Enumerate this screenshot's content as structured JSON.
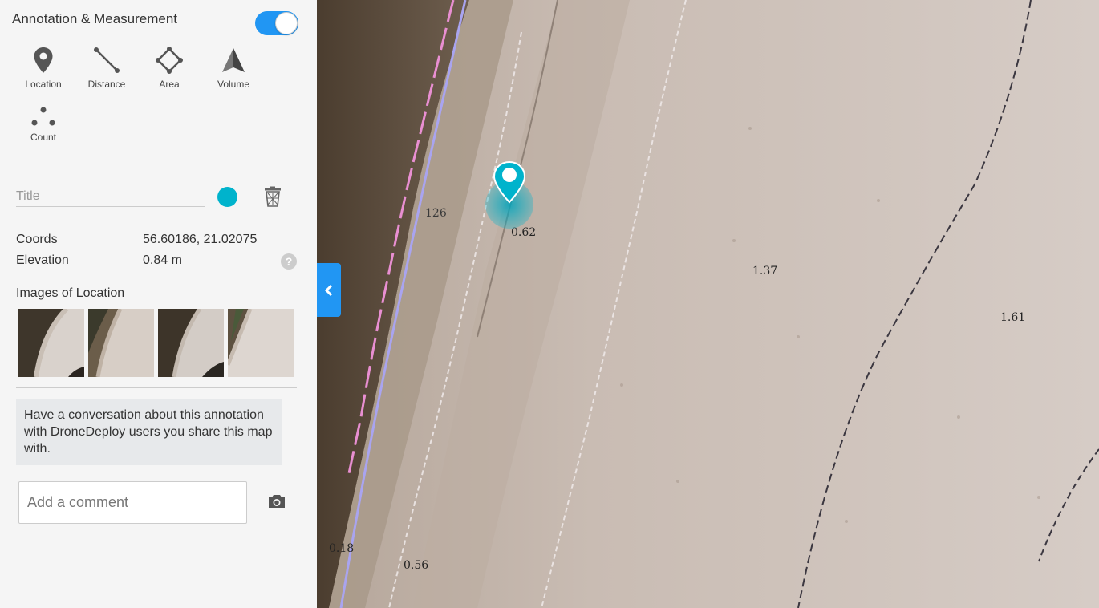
{
  "panel": {
    "title": "Annotation & Measurement",
    "toggle_on": true
  },
  "tools": [
    {
      "label": "Location",
      "icon": "location-pin-icon"
    },
    {
      "label": "Distance",
      "icon": "distance-line-icon"
    },
    {
      "label": "Area",
      "icon": "area-polygon-icon"
    },
    {
      "label": "Volume",
      "icon": "volume-pyramid-icon"
    },
    {
      "label": "Count",
      "icon": "count-dots-icon"
    }
  ],
  "annotation": {
    "title_placeholder": "Title",
    "title_value": "",
    "color": "#00b3cc"
  },
  "info": {
    "coords_label": "Coords",
    "coords_value": "56.60186, 21.02075",
    "elevation_label": "Elevation",
    "elevation_value": "0.84 m",
    "help_icon": "question-mark-icon",
    "help_glyph": "?"
  },
  "images": {
    "heading": "Images of Location",
    "count": 4
  },
  "conversation": {
    "note": "Have a conversation about this annotation with DroneDeploy users you share this map with.",
    "comment_placeholder": "Add a comment",
    "camera_icon": "camera-icon"
  },
  "map": {
    "elevation_labels": [
      "0.62",
      "1.37",
      "1.61",
      "0.18",
      "0.56",
      "126"
    ],
    "colors": {
      "accent": "#2196f3",
      "pin": "#00b3cc",
      "sand": "#cdbfb7",
      "water": "#4a3e33"
    }
  }
}
